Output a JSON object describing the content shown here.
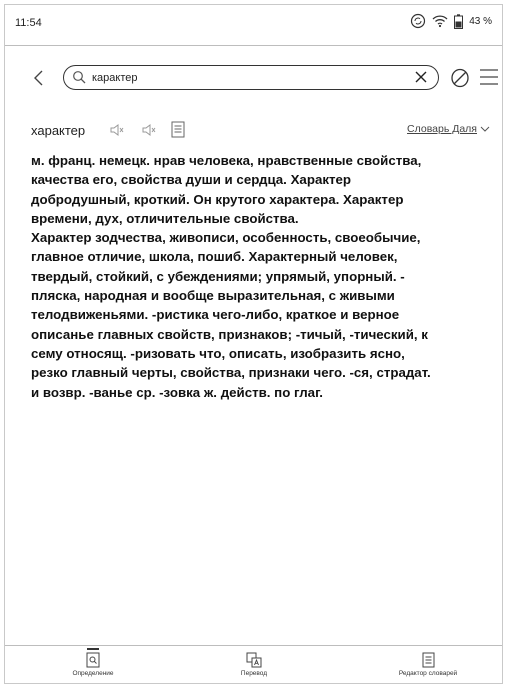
{
  "status": {
    "time": "11:54",
    "battery": "43 %"
  },
  "search": {
    "query": "карактер"
  },
  "entry": {
    "word": "характер",
    "dictionary": "Словарь Даля",
    "lines": [
      "м. франц. немецк. нрав человека, нравственные свойства,",
      "качества его, свойства души и сердца. Характер",
      "добродушный, кроткий. Он крутого характера. Характер",
      "времени, дух, отличительные свойства.",
      "Характер зодчества, живописи, особенность, своеобычие,",
      "главное отличие, школа, пошиб. Характерный человек,",
      "твердый, стойкий, с убеждениями; упрямый, упорный. -",
      "пляска, народная и вообще выразительная, с живыми",
      "телодвиженьями. -ристика чего-либо, краткое и верное",
      "описанье главных свойств, признаков; -тичый, -тический, к",
      "сему относящ. -ризовать что, описать, изобразить ясно,",
      "резко главный черты, свойства, признаки чего. -ся, страдат.",
      "и возвр. -ванье ср. -зовка ж. действ. по глаг."
    ]
  },
  "tabs": [
    {
      "label": "Определение",
      "icon": "definition-icon"
    },
    {
      "label": "Перевод",
      "icon": "translate-icon"
    },
    {
      "label": "Редактор словарей",
      "icon": "dictionary-editor-icon"
    }
  ]
}
